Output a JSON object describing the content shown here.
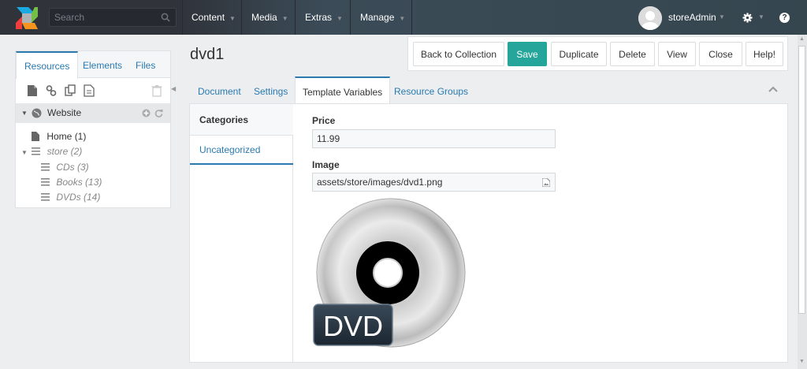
{
  "search": {
    "placeholder": "Search"
  },
  "nav": [
    {
      "label": "Content"
    },
    {
      "label": "Media"
    },
    {
      "label": "Extras"
    },
    {
      "label": "Manage"
    }
  ],
  "user": {
    "name": "storeAdmin"
  },
  "left_tabs": [
    "Resources",
    "Elements",
    "Files"
  ],
  "tree": {
    "root": "Website",
    "nodes": [
      {
        "label": "Home (1)"
      },
      {
        "label": "store (2)"
      },
      {
        "label": "CDs (3)"
      },
      {
        "label": "Books (13)"
      },
      {
        "label": "DVDs (14)"
      }
    ]
  },
  "page": {
    "title": "dvd1"
  },
  "actions": [
    "Back to Collection",
    "Save",
    "Duplicate",
    "Delete",
    "View",
    "Close",
    "Help!"
  ],
  "tabs": [
    "Document",
    "Settings",
    "Template Variables",
    "Resource Groups"
  ],
  "categories": {
    "header": "Categories",
    "item": "Uncategorized"
  },
  "tv": {
    "price_label": "Price",
    "price_value": "11.99",
    "image_label": "Image",
    "image_value": "assets/store/images/dvd1.png"
  },
  "dvd_logo_text": "DVD",
  "colors": {
    "accent": "#2a7ab0",
    "primary_button": "#26a69a",
    "topbar": "#30333a"
  }
}
